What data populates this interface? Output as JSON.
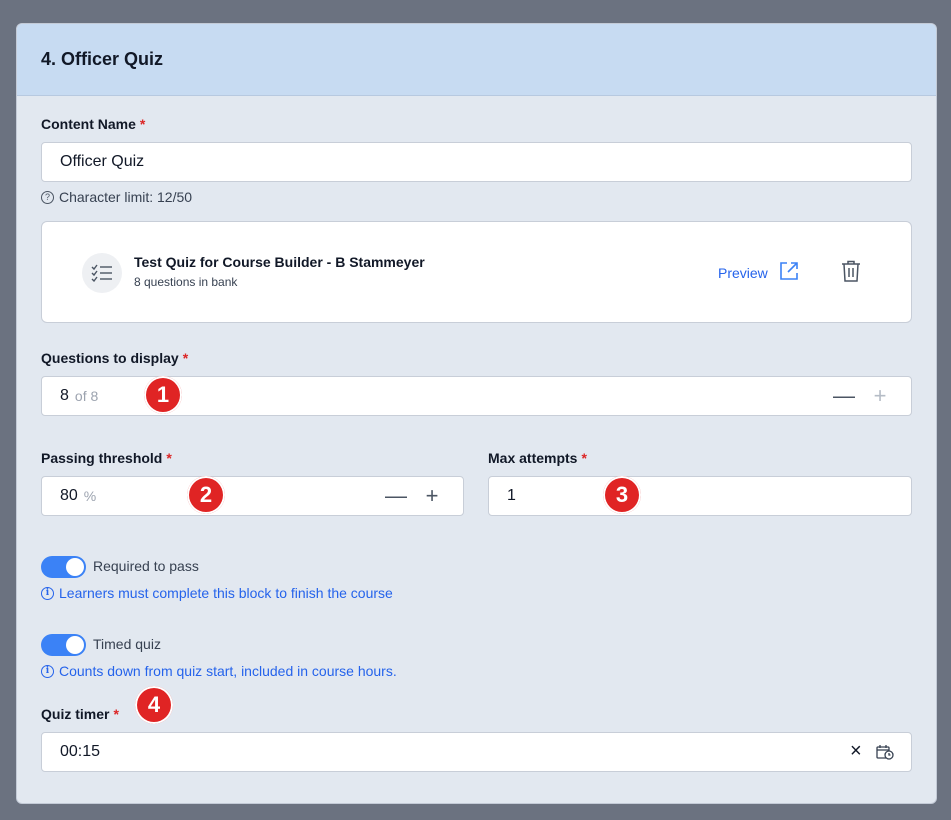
{
  "card": {
    "title": "4. Officer Quiz"
  },
  "content_name": {
    "label": "Content Name",
    "required_mark": "*",
    "value": "Officer Quiz",
    "hint_icon": "?",
    "hint": "Character limit: 12/50"
  },
  "quiz": {
    "icon": "checklist-icon",
    "name": "Test Quiz for Course Builder - B Stammeyer",
    "questions_in_bank": "8 questions in bank",
    "preview_label": "Preview"
  },
  "questions_to_display": {
    "label": "Questions to display",
    "required_mark": "*",
    "value": "8",
    "suffix": "of 8",
    "decrement": "—",
    "increment": "+"
  },
  "passing_threshold": {
    "label": "Passing threshold",
    "required_mark": "*",
    "value": "80",
    "suffix": "%",
    "decrement": "—",
    "increment": "+"
  },
  "max_attempts": {
    "label": "Max attempts",
    "required_mark": "*",
    "value": "1"
  },
  "required_to_pass": {
    "enabled": true,
    "label": "Required to pass",
    "info_icon": "i",
    "info": "Learners must complete this block to finish the course"
  },
  "timed_quiz": {
    "enabled": true,
    "label": "Timed quiz",
    "info_icon": "i",
    "info": "Counts down from quiz start, included in course hours."
  },
  "quiz_timer": {
    "label": "Quiz timer",
    "required_mark": "*",
    "value": "00:15",
    "clear_icon": "×"
  },
  "annotations": [
    "1",
    "2",
    "3",
    "4"
  ],
  "colors": {
    "accent": "#3b82f6",
    "link": "#2563eb",
    "required": "#dc2626",
    "badge": "#e02424",
    "header": "#c7dbf2"
  }
}
